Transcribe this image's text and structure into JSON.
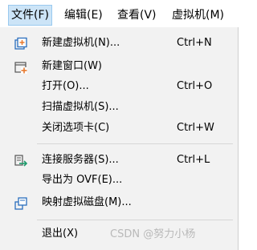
{
  "menubar": {
    "items": [
      {
        "label": "文件(F)"
      },
      {
        "label": "编辑(E)"
      },
      {
        "label": "查看(V)"
      },
      {
        "label": "虚拟机(M)"
      }
    ]
  },
  "file_menu": {
    "items": [
      {
        "label": "新建虚拟机(N)...",
        "shortcut": "Ctrl+N",
        "icon": "new-vm-icon"
      },
      {
        "label": "新建窗口(W)",
        "shortcut": "",
        "icon": "new-window-icon"
      },
      {
        "label": "打开(O)...",
        "shortcut": "Ctrl+O"
      },
      {
        "label": "扫描虚拟机(S)...",
        "shortcut": ""
      },
      {
        "label": "关闭选项卡(C)",
        "shortcut": "Ctrl+W"
      },
      {
        "label": "连接服务器(S)...",
        "shortcut": "Ctrl+L",
        "icon": "connect-server-icon"
      },
      {
        "label": "导出为 OVF(E)...",
        "shortcut": ""
      },
      {
        "label": "映射虚拟磁盘(M)...",
        "shortcut": "",
        "icon": "map-disk-icon"
      },
      {
        "label": "退出(X)",
        "shortcut": ""
      }
    ]
  },
  "watermark": "CSDN @努力小杨",
  "colors": {
    "accent_orange": "#e8782c",
    "accent_blue": "#2a6ebd",
    "active_highlight": "#cce4f7"
  }
}
